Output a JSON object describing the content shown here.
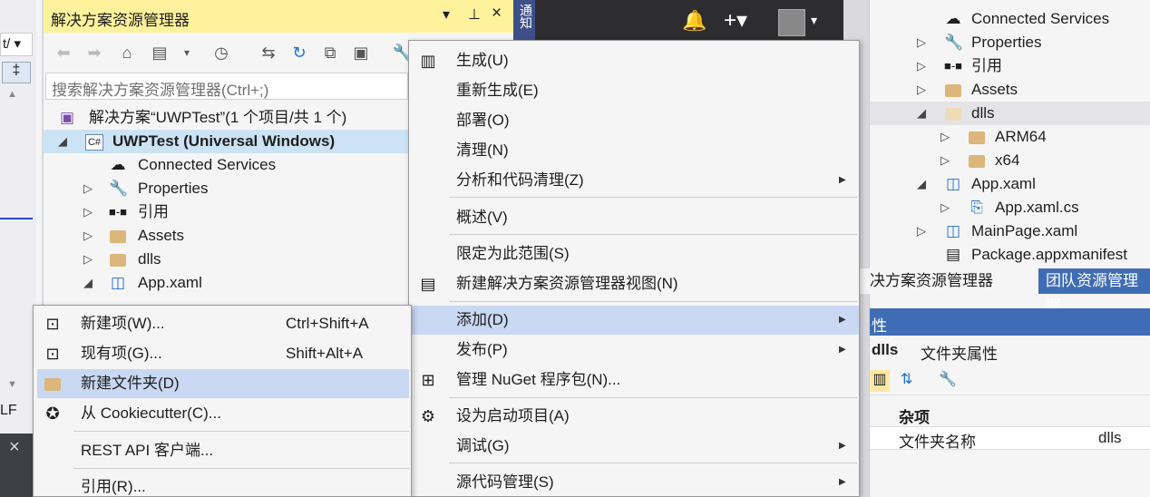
{
  "left_strip": {
    "close_glyph": "×",
    "lf_text": "LF",
    "dropdown_text": "t/"
  },
  "solution_explorer": {
    "title": "解决方案资源管理器",
    "title_controls": [
      "▾",
      "⊥",
      "×"
    ],
    "search_placeholder": "搜索解决方案资源管理器(Ctrl+;)",
    "toolbar_icons": [
      "back-icon",
      "forward-icon",
      "home-icon",
      "switch-views-icon",
      "history-icon",
      "sync-icon",
      "refresh-icon",
      "collapse-icon",
      "show-all-icon",
      "properties-icon"
    ],
    "tree": [
      {
        "label": "解决方案“UWPTest”(1 个项目/共 1 个)",
        "icon": "solution-icon",
        "bold": false
      },
      {
        "label": "UWPTest (Universal Windows)",
        "icon": "csharp-project-icon",
        "bold": true
      },
      {
        "label": "Connected Services",
        "icon": "cloud-icon"
      },
      {
        "label": "Properties",
        "icon": "wrench-icon"
      },
      {
        "label": "引用",
        "icon": "references-icon"
      },
      {
        "label": "Assets",
        "icon": "folder-icon"
      },
      {
        "label": "dlls",
        "icon": "folder-icon"
      },
      {
        "label": "App.xaml",
        "icon": "xaml-icon"
      },
      {
        "label": "App.xaml.cs",
        "icon": "cs-file-icon"
      }
    ]
  },
  "top_bar": {
    "notif_tab": "通知",
    "avatar_alt": "user"
  },
  "context_menu": {
    "items": [
      {
        "label": "生成(U)",
        "icon": "build-icon"
      },
      {
        "label": "重新生成(E)"
      },
      {
        "label": "部署(O)"
      },
      {
        "label": "清理(N)"
      },
      {
        "label": "分析和代码清理(Z)",
        "submenu": true
      },
      {
        "label": "概述(V)"
      },
      {
        "label": "限定为此范围(S)"
      },
      {
        "label": "新建解决方案资源管理器视图(N)",
        "icon": "new-view-icon"
      },
      {
        "label": "添加(D)",
        "submenu": true,
        "highlighted": true
      },
      {
        "label": "发布(P)",
        "submenu": true
      },
      {
        "label": "管理 NuGet 程序包(N)...",
        "icon": "nuget-icon"
      },
      {
        "label": "设为启动项目(A)",
        "icon": "gear-icon"
      },
      {
        "label": "调试(G)",
        "submenu": true
      },
      {
        "label": "源代码管理(S)",
        "submenu": true
      }
    ]
  },
  "add_submenu": {
    "items": [
      {
        "label": "新建项(W)...",
        "shortcut": "Ctrl+Shift+A",
        "icon": "new-item-icon"
      },
      {
        "label": "现有项(G)...",
        "shortcut": "Shift+Alt+A",
        "icon": "existing-item-icon"
      },
      {
        "label": "新建文件夹(D)",
        "shortcut": "",
        "icon": "new-folder-icon",
        "highlighted": true
      },
      {
        "label": "从 Cookiecutter(C)...",
        "shortcut": "",
        "icon": "cookiecutter-icon"
      },
      {
        "label": "REST API 客户端...",
        "shortcut": ""
      },
      {
        "label": "引用(R)...",
        "shortcut": ""
      }
    ]
  },
  "right_panel": {
    "tree": [
      {
        "label": "Connected Services",
        "icon": "cloud-icon"
      },
      {
        "label": "Properties",
        "icon": "wrench-icon"
      },
      {
        "label": "引用",
        "icon": "references-icon"
      },
      {
        "label": "Assets",
        "icon": "folder-icon"
      },
      {
        "label": "dlls",
        "icon": "folder-icon"
      },
      {
        "label": "ARM64",
        "icon": "folder-icon"
      },
      {
        "label": "x64",
        "icon": "folder-icon"
      },
      {
        "label": "App.xaml",
        "icon": "xaml-icon"
      },
      {
        "label": "App.xaml.cs",
        "icon": "cs-file-icon"
      },
      {
        "label": "MainPage.xaml",
        "icon": "xaml-icon"
      },
      {
        "label": "Package.appxmanifest",
        "icon": "manifest-icon"
      }
    ],
    "tabs": [
      "决方案资源管理器",
      "团队资源管理器"
    ],
    "props_header": "性",
    "props_object": "dlls",
    "props_object_type": "文件夹属性",
    "props_category": "杂项",
    "prop_name": "文件夹名称",
    "prop_value": "dlls"
  },
  "colors": {
    "title_yellow": "#fff29d",
    "highlight": "#c9d8f3",
    "selection": "#cce3f5",
    "accent_blue": "#3e6db5",
    "dark": "#2d2d30"
  }
}
